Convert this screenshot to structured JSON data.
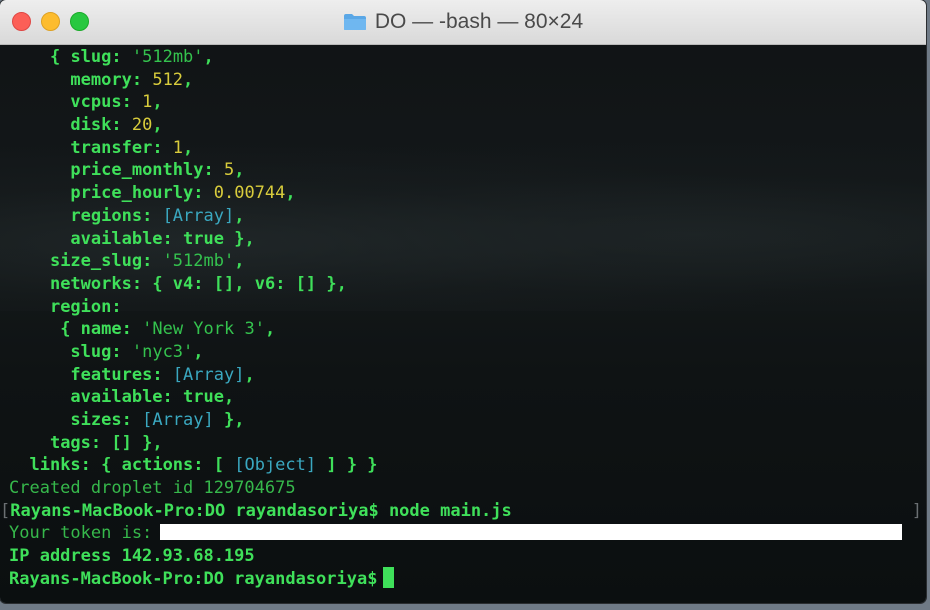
{
  "window": {
    "title": "DO — -bash — 80×24",
    "folder_icon": "folder-icon",
    "controls": [
      "close",
      "minimize",
      "zoom"
    ]
  },
  "terminal": {
    "lines": [
      {
        "indent": "    ",
        "parts": [
          [
            "pun",
            "{ "
          ],
          [
            "g",
            "slug"
          ],
          [
            "pun",
            ": "
          ],
          [
            "str",
            "'512mb'"
          ],
          [
            "pun",
            ","
          ]
        ]
      },
      {
        "indent": "      ",
        "parts": [
          [
            "g",
            "memory"
          ],
          [
            "pun",
            ": "
          ],
          [
            "num",
            "512"
          ],
          [
            "pun",
            ","
          ]
        ]
      },
      {
        "indent": "      ",
        "parts": [
          [
            "g",
            "vcpus"
          ],
          [
            "pun",
            ": "
          ],
          [
            "num",
            "1"
          ],
          [
            "pun",
            ","
          ]
        ]
      },
      {
        "indent": "      ",
        "parts": [
          [
            "g",
            "disk"
          ],
          [
            "pun",
            ": "
          ],
          [
            "num",
            "20"
          ],
          [
            "pun",
            ","
          ]
        ]
      },
      {
        "indent": "      ",
        "parts": [
          [
            "g",
            "transfer"
          ],
          [
            "pun",
            ": "
          ],
          [
            "num",
            "1"
          ],
          [
            "pun",
            ","
          ]
        ]
      },
      {
        "indent": "      ",
        "parts": [
          [
            "g",
            "price_monthly"
          ],
          [
            "pun",
            ": "
          ],
          [
            "num",
            "5"
          ],
          [
            "pun",
            ","
          ]
        ]
      },
      {
        "indent": "      ",
        "parts": [
          [
            "g",
            "price_hourly"
          ],
          [
            "pun",
            ": "
          ],
          [
            "num",
            "0.00744"
          ],
          [
            "pun",
            ","
          ]
        ]
      },
      {
        "indent": "      ",
        "parts": [
          [
            "g",
            "regions"
          ],
          [
            "pun",
            ": "
          ],
          [
            "arr",
            "[Array]"
          ],
          [
            "pun",
            ","
          ]
        ]
      },
      {
        "indent": "      ",
        "parts": [
          [
            "g",
            "available"
          ],
          [
            "pun",
            ": "
          ],
          [
            "g",
            "true"
          ],
          [
            "pun",
            " },"
          ]
        ]
      },
      {
        "indent": "    ",
        "parts": [
          [
            "g",
            "size_slug"
          ],
          [
            "pun",
            ": "
          ],
          [
            "str",
            "'512mb'"
          ],
          [
            "pun",
            ","
          ]
        ]
      },
      {
        "indent": "    ",
        "parts": [
          [
            "g",
            "networks"
          ],
          [
            "pun",
            ": { "
          ],
          [
            "g",
            "v4"
          ],
          [
            "pun",
            ": [], "
          ],
          [
            "g",
            "v6"
          ],
          [
            "pun",
            ": [] },"
          ]
        ]
      },
      {
        "indent": "    ",
        "parts": [
          [
            "g",
            "region"
          ],
          [
            "pun",
            ":"
          ]
        ]
      },
      {
        "indent": "     ",
        "parts": [
          [
            "pun",
            "{ "
          ],
          [
            "g",
            "name"
          ],
          [
            "pun",
            ": "
          ],
          [
            "str",
            "'New York 3'"
          ],
          [
            "pun",
            ","
          ]
        ]
      },
      {
        "indent": "      ",
        "parts": [
          [
            "g",
            "slug"
          ],
          [
            "pun",
            ": "
          ],
          [
            "str",
            "'nyc3'"
          ],
          [
            "pun",
            ","
          ]
        ]
      },
      {
        "indent": "      ",
        "parts": [
          [
            "g",
            "features"
          ],
          [
            "pun",
            ": "
          ],
          [
            "arr",
            "[Array]"
          ],
          [
            "pun",
            ","
          ]
        ]
      },
      {
        "indent": "      ",
        "parts": [
          [
            "g",
            "available"
          ],
          [
            "pun",
            ": "
          ],
          [
            "g",
            "true"
          ],
          [
            "pun",
            ","
          ]
        ]
      },
      {
        "indent": "      ",
        "parts": [
          [
            "g",
            "sizes"
          ],
          [
            "pun",
            ": "
          ],
          [
            "arr",
            "[Array]"
          ],
          [
            "pun",
            " },"
          ]
        ]
      },
      {
        "indent": "    ",
        "parts": [
          [
            "g",
            "tags"
          ],
          [
            "pun",
            ": [] },"
          ]
        ]
      },
      {
        "indent": "  ",
        "parts": [
          [
            "g",
            "links"
          ],
          [
            "pun",
            ": { "
          ],
          [
            "g",
            "actions"
          ],
          [
            "pun",
            ": [ "
          ],
          [
            "arr",
            "[Object]"
          ],
          [
            "pun",
            " ] } }"
          ]
        ]
      }
    ],
    "created_line": "Created droplet id 129704675",
    "prompt_command": "Rayans-MacBook-Pro:DO rayandasoriya$ node main.js",
    "token_label": "Your token is:",
    "ip_line": "IP address 142.93.68.195",
    "final_prompt": "Rayans-MacBook-Pro:DO rayandasoriya$",
    "scroll_bracket_left": "[",
    "scroll_bracket_right": "]"
  },
  "colors": {
    "green": "#3fe05a",
    "yellow_number": "#d8cc3c",
    "cyan_array": "#3aa8c0",
    "token_redaction": "#ffffff"
  }
}
